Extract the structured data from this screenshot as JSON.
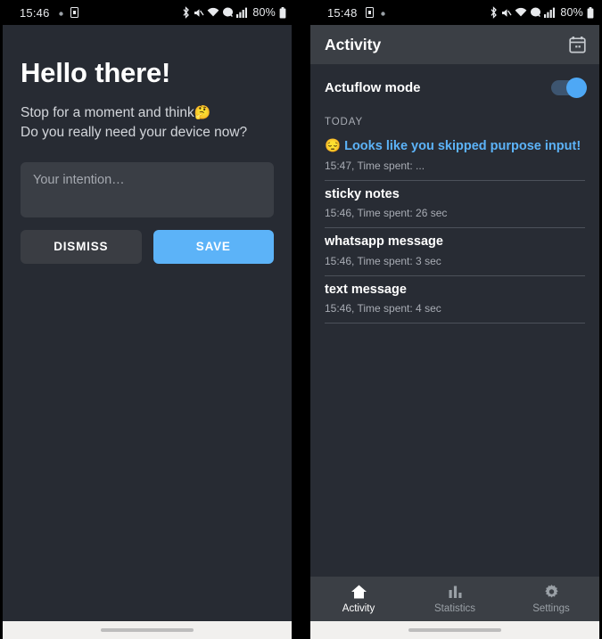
{
  "left_screen": {
    "statusbar": {
      "clock": "15:46",
      "battery_text": "80%",
      "icons": [
        "dot-icon",
        "sim-icon",
        "bluetooth-icon",
        "mute-icon",
        "wifi-icon",
        "vpn-icon",
        "signal-icon",
        "battery-icon"
      ]
    },
    "greeting": "Hello there!",
    "prompt_line1": "Stop for a moment and think",
    "prompt_emoji": "🤔",
    "prompt_line2": "Do you really need your device now?",
    "intention_input": {
      "placeholder": "Your intention…",
      "value": ""
    },
    "buttons": {
      "dismiss": "DISMISS",
      "save": "SAVE"
    }
  },
  "right_screen": {
    "statusbar": {
      "clock": "15:48",
      "battery_text": "80%",
      "icons": [
        "sim-icon",
        "dot-icon",
        "bluetooth-icon",
        "mute-icon",
        "wifi-icon",
        "vpn-icon",
        "signal-icon",
        "battery-icon"
      ]
    },
    "appbar": {
      "title": "Activity",
      "calendar_icon": "calendar-icon"
    },
    "mode_row": {
      "label": "Actuflow mode",
      "toggle_on": true
    },
    "day_label": "TODAY",
    "items": [
      {
        "emoji": "😔",
        "title": "Looks like you skipped purpose input!",
        "subtitle": "15:47, Time spent: ...",
        "highlight": true
      },
      {
        "emoji": "",
        "title": "sticky notes",
        "subtitle": "15:46, Time spent: 26 sec",
        "highlight": false
      },
      {
        "emoji": "",
        "title": "whatsapp message",
        "subtitle": "15:46, Time spent: 3 sec",
        "highlight": false
      },
      {
        "emoji": "",
        "title": "text message",
        "subtitle": "15:46, Time spent: 4 sec",
        "highlight": false
      }
    ],
    "bottom_nav": [
      {
        "label": "Activity",
        "icon": "home-icon",
        "active": true
      },
      {
        "label": "Statistics",
        "icon": "chart-icon",
        "active": false
      },
      {
        "label": "Settings",
        "icon": "gear-icon",
        "active": false
      }
    ]
  },
  "colors": {
    "accent_blue": "#5cb3f8",
    "body_bg": "#282c34",
    "bar_bg": "#3b3f45",
    "muted_text": "#a8acb4"
  }
}
